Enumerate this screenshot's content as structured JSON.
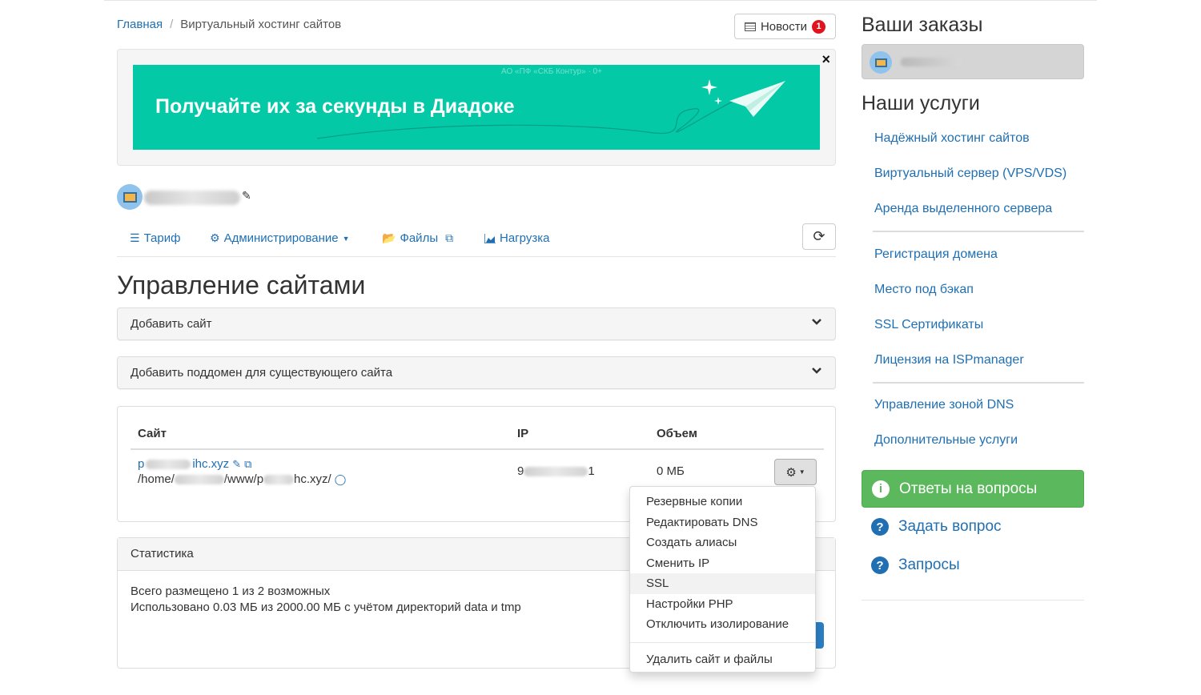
{
  "breadcrumb": {
    "home": "Главная",
    "separator": "/",
    "current": "Виртуальный хостинг сайтов"
  },
  "news": {
    "label": "Новости",
    "count": "1"
  },
  "banner": {
    "small_text": "АО «ПФ «СКБ Контур» · 0+",
    "big_text": "Получайте их за секунды в Диадоке",
    "close": "×",
    "bg_color": "#03c9a6"
  },
  "account": {
    "edit_icon": "pencil-icon"
  },
  "tabs": [
    {
      "label": "Тариф",
      "icon": "sliders-icon"
    },
    {
      "label": "Администрирование",
      "icon": "gear-icon"
    },
    {
      "label": "Файлы",
      "icon": "folder-open-icon"
    },
    {
      "label": "Нагрузка",
      "icon": "area-chart-icon"
    }
  ],
  "page_title": "Управление сайтами",
  "accordions": [
    {
      "label": "Добавить сайт"
    },
    {
      "label": "Добавить поддомен для существующего сайта"
    }
  ],
  "sites_table": {
    "headers": [
      "Сайт",
      "IP",
      "Объем"
    ],
    "rows": [
      {
        "site_prefix": "p",
        "site_suffix": "ihc.xyz",
        "path_prefix": "/home/",
        "path_middle": "/www/p",
        "path_suffix": "hc.xyz/",
        "ip_prefix": "9",
        "ip_suffix": "1",
        "size": "0 МБ"
      }
    ]
  },
  "actions_menu": {
    "items": [
      "Резервные копии",
      "Редактировать DNS",
      "Создать алиасы",
      "Сменить IP",
      "SSL",
      "Настройки PHP",
      "Отключить изолирование"
    ],
    "active_item": "SSL",
    "danger_item": "Удалить сайт и файлы"
  },
  "stats": {
    "title": "Статистика",
    "line1": "Всего размещено 1 из 2 возможных",
    "line2": "Использовано 0.03 МБ из 2000.00 МБ с учётом директорий data и tmp"
  },
  "sidebar": {
    "orders_title": "Ваши заказы",
    "services_title": "Наши услуги",
    "services": [
      "Надёжный хостинг сайтов",
      "Виртуальный сервер (VPS/VDS)",
      "Аренда выделенного сервера",
      "Регистрация домена",
      "Место под бэкап",
      "SSL Сертификаты",
      "Лицензия на ISPmanager",
      "Управление зоной DNS",
      "Дополнительные услуги"
    ],
    "faq_label": "Ответы на вопросы",
    "ask_label": "Задать вопрос",
    "requests_label": "Запросы"
  },
  "colors": {
    "link": "#1f6fb2",
    "success": "#5cb85c",
    "badge": "#e0141e"
  }
}
